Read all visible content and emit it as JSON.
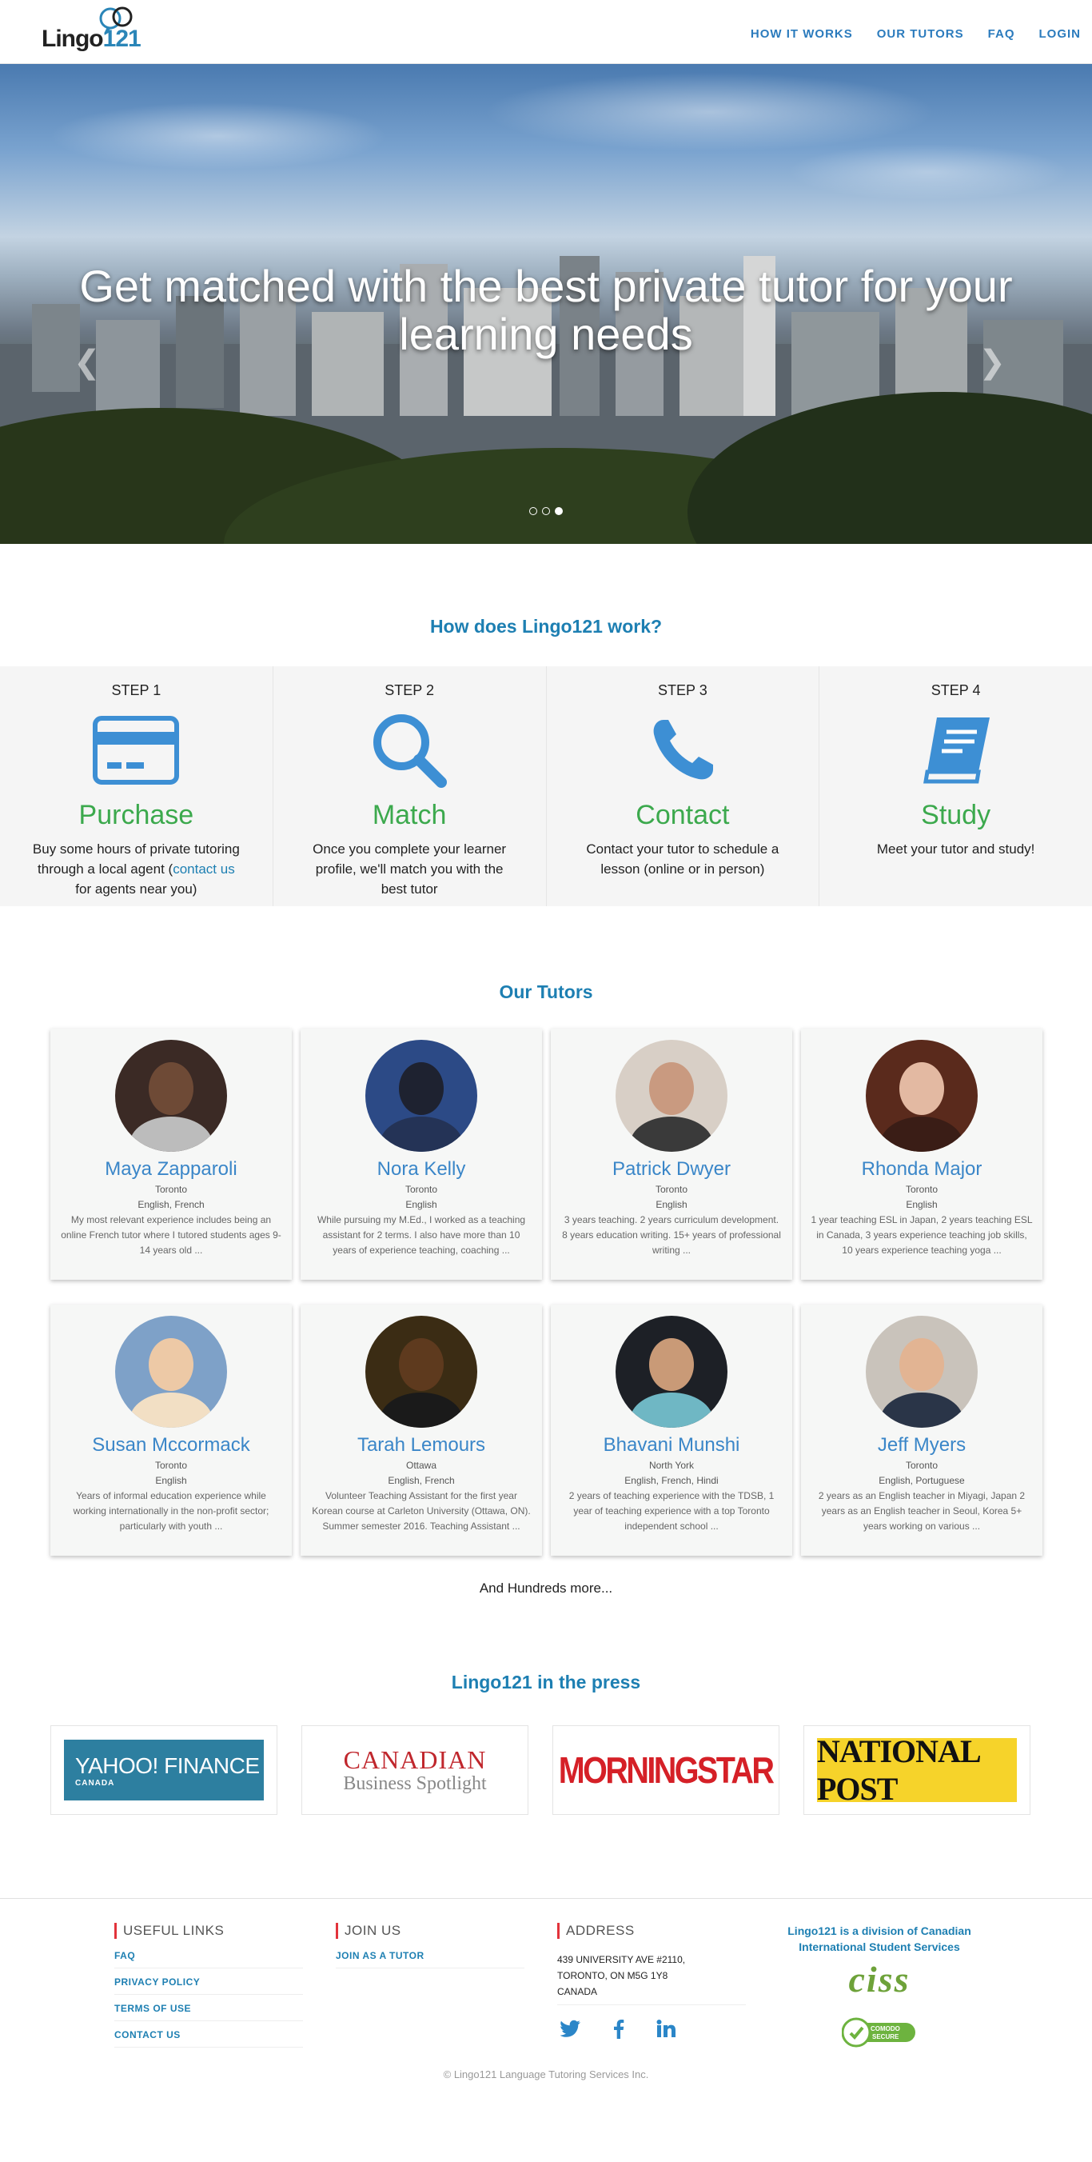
{
  "brand": {
    "logo_text_a": "Lingo",
    "logo_text_b": "121"
  },
  "nav": [
    {
      "label": "HOW IT WORKS"
    },
    {
      "label": "OUR TUTORS"
    },
    {
      "label": "FAQ"
    },
    {
      "label": "LOGIN"
    }
  ],
  "hero": {
    "title": "Get matched with the best private tutor for your learning needs",
    "slides_total": 3,
    "active_slide": 3
  },
  "how": {
    "title": "How does Lingo121 work?",
    "steps": [
      {
        "num": "STEP 1",
        "name": "Purchase",
        "icon": "credit-card-icon",
        "desc_a": "Buy some hours of private tutoring through a local agent (",
        "link": "contact us",
        "desc_b": " for agents near you)"
      },
      {
        "num": "STEP 2",
        "name": "Match",
        "icon": "search-icon",
        "desc_a": "Once you complete your learner profile, we'll match you with the best tutor",
        "link": "",
        "desc_b": ""
      },
      {
        "num": "STEP 3",
        "name": "Contact",
        "icon": "phone-icon",
        "desc_a": "Contact your tutor to schedule a lesson (online or in person)",
        "link": "",
        "desc_b": ""
      },
      {
        "num": "STEP 4",
        "name": "Study",
        "icon": "book-icon",
        "desc_a": "Meet your tutor and study!",
        "link": "",
        "desc_b": ""
      }
    ]
  },
  "tutors": {
    "title": "Our Tutors",
    "items": [
      {
        "name": "Maya Zapparoli",
        "city": "Toronto",
        "languages": "English, French",
        "bio": "My most relevant experience includes being an online French tutor where I tutored students ages 9-14 years old ...",
        "bg": "#3b2a25",
        "skin": "#6e4a36",
        "shirt": "#bcbcbc"
      },
      {
        "name": "Nora Kelly",
        "city": "Toronto",
        "languages": "English",
        "bio": "While pursuing my M.Ed., I worked as a teaching assistant for 2 terms. I also have more than 10 years of experience teaching, coaching ...",
        "bg": "#2c4a86",
        "skin": "#1e2230",
        "shirt": "#243356"
      },
      {
        "name": "Patrick Dwyer",
        "city": "Toronto",
        "languages": "English",
        "bio": "3 years teaching. 2 years curriculum development. 8 years education writing. 15+ years of professional writing ...",
        "bg": "#d8cfc6",
        "skin": "#c99a80",
        "shirt": "#3a3a3a"
      },
      {
        "name": "Rhonda Major",
        "city": "Toronto",
        "languages": "English",
        "bio": "1 year teaching ESL in Japan, 2 years teaching ESL in Canada, 3 years experience teaching job skills, 10 years experience teaching yoga ...",
        "bg": "#5a2a1c",
        "skin": "#e3b9a2",
        "shirt": "#3a1d16"
      },
      {
        "name": "Susan Mccormack",
        "city": "Toronto",
        "languages": "English",
        "bio": "Years of informal education experience while working internationally in the non-profit sector; particularly with youth ...",
        "bg": "#7ea1c8",
        "skin": "#edc9a6",
        "shirt": "#f2dfc4"
      },
      {
        "name": "Tarah Lemours",
        "city": "Ottawa",
        "languages": "English, French",
        "bio": "Volunteer Teaching Assistant for the first year Korean course at Carleton University (Ottawa, ON). Summer semester 2016. Teaching Assistant ...",
        "bg": "#3b2c14",
        "skin": "#5e3a1e",
        "shirt": "#1a1a1a"
      },
      {
        "name": "Bhavani Munshi",
        "city": "North York",
        "languages": "English, French, Hindi",
        "bio": "2 years of teaching experience with the TDSB, 1 year of teaching experience with a top Toronto independent school ...",
        "bg": "#1d2026",
        "skin": "#c99a77",
        "shirt": "#6fb7c4"
      },
      {
        "name": "Jeff Myers",
        "city": "Toronto",
        "languages": "English, Portuguese",
        "bio": "2 years as an English teacher in Miyagi, Japan 2 years as an English teacher in Seoul, Korea 5+ years working on various ...",
        "bg": "#c9c3bb",
        "skin": "#e2b493",
        "shirt": "#2a3548"
      }
    ],
    "more": "And Hundreds more..."
  },
  "press": {
    "title": "Lingo121 in the press",
    "yahoo_a": "YAHOO! FINANCE",
    "yahoo_b": "CANADA",
    "cbs_a": "CANADIAN",
    "cbs_b": "Business Spotlight",
    "morningstar": "MORNINGSTAR",
    "national_post": "NATIONAL POST"
  },
  "footer": {
    "useful_title": "USEFUL LINKS",
    "useful_links": [
      "FAQ",
      "PRIVACY POLICY",
      "TERMS OF USE",
      "CONTACT US"
    ],
    "join_title": "JOIN US",
    "join_links": [
      "JOIN AS A TUTOR"
    ],
    "address_title": "ADDRESS",
    "address_lines": [
      "439 UNIVERSITY AVE #2110,",
      "TORONTO, ON M5G 1Y8",
      "CANADA"
    ],
    "ciss_text": "Lingo121 is a division of Canadian International Student Services",
    "ciss_logo": "ciss",
    "comodo_a": "COMODO",
    "comodo_b": "SECURE",
    "copyright": "© Lingo121 Language Tutoring Services Inc."
  },
  "colors": {
    "accent": "#1d7fb2",
    "step_green": "#3ca94d",
    "tutor_name": "#3a86c8",
    "footer_red": "#e2333b"
  }
}
